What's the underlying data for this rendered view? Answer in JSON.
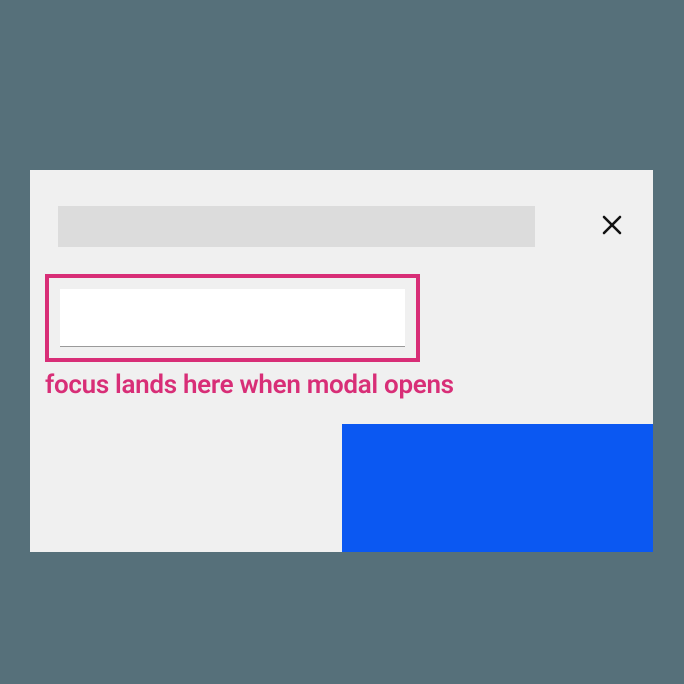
{
  "modal": {
    "title": "",
    "input_value": "",
    "input_placeholder": "",
    "annotation": "focus lands here when modal opens",
    "close_label": "Close",
    "primary_button_label": ""
  },
  "colors": {
    "backdrop": "#56707a",
    "modal_bg": "#f0f0f0",
    "title_placeholder": "#dcdcdc",
    "focus_ring": "#d82e77",
    "annotation": "#d82e77",
    "primary": "#0b58f2",
    "input_bg": "#ffffff"
  }
}
